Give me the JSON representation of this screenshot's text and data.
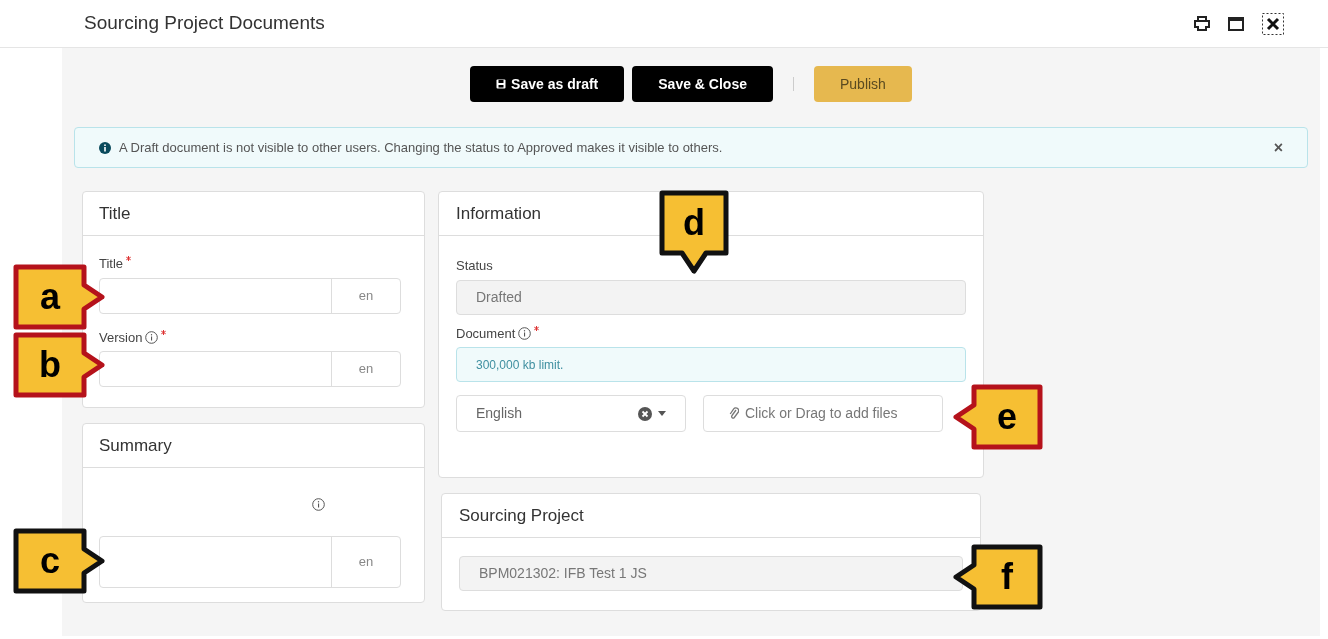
{
  "window": {
    "title": "Sourcing Project Documents"
  },
  "toolbar": {
    "buttons": [
      {
        "label": "Save as draft",
        "kind": "draft"
      },
      {
        "label": "Save & Close",
        "kind": "dark"
      },
      {
        "label": "Publish",
        "kind": "primary"
      }
    ]
  },
  "banner": {
    "text": "A Draft document is not visible to other users. Changing the status to Approved makes it visible to others.",
    "close": "×"
  },
  "title_card": {
    "heading": "Title",
    "fields": [
      {
        "label": "Title",
        "info": false,
        "required": true,
        "suffix": "en"
      },
      {
        "label": "Version",
        "info": true,
        "required": true,
        "suffix": "en"
      }
    ]
  },
  "summary_card": {
    "heading": "Summary",
    "info": true,
    "suffix": "en"
  },
  "information_card": {
    "heading": "Information",
    "status_label": "Status",
    "status_value": "Drafted",
    "document_label": "Document",
    "document_info": true,
    "document_required": true,
    "document_hint": "300,000 kb limit.",
    "language": "English",
    "upload": "Click or Drag to add files"
  },
  "sourcing_project_card": {
    "heading": "Sourcing Project",
    "value": "BPM021302: IFB Test 1 JS"
  },
  "callouts": [
    {
      "letter": "a",
      "kind": "right",
      "color": "#b5121b"
    },
    {
      "letter": "b",
      "kind": "right",
      "color": "#b5121b"
    },
    {
      "letter": "c",
      "kind": "right",
      "color": "#111111"
    },
    {
      "letter": "d",
      "kind": "down",
      "color": "#111111"
    },
    {
      "letter": "e",
      "kind": "left",
      "color": "#b5121b"
    },
    {
      "letter": "f",
      "kind": "left",
      "color": "#111111"
    }
  ]
}
